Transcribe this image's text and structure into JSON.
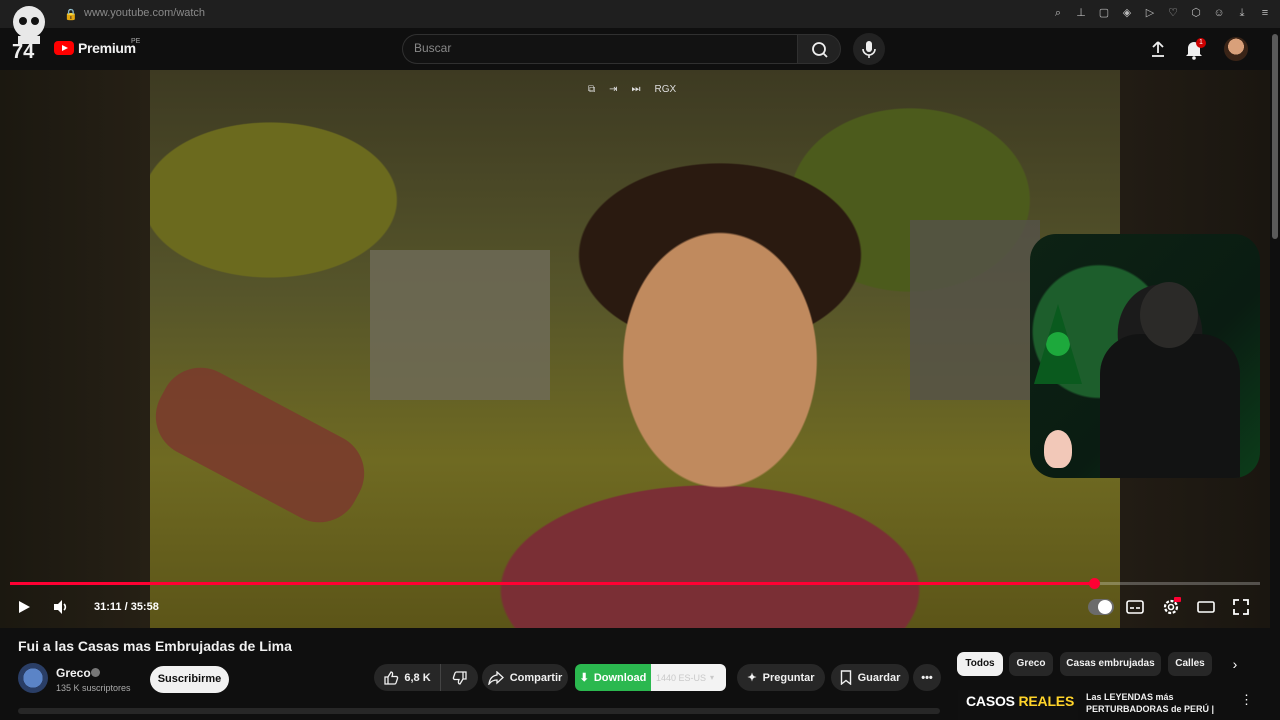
{
  "browser": {
    "url": "www.youtube.com/watch",
    "ext_icons": [
      "zoom-icon",
      "pin-icon",
      "crop-icon",
      "shield-icon",
      "play-icon",
      "heart-icon",
      "extension-icon",
      "person-icon",
      "download-icon",
      "menu-icon"
    ]
  },
  "header": {
    "logo_text": "Premium",
    "logo_country": "PE",
    "search_placeholder": "Buscar",
    "notifications_count": "1"
  },
  "player": {
    "overlay_label": "RGX",
    "current_time": "31:11",
    "duration": "35:58",
    "time_display": "31:11 / 35:58",
    "progress_fraction": 0.867,
    "accent_color": "#ff0033"
  },
  "video": {
    "title": "Fui a las Casas mas Embrujadas de Lima",
    "channel_name": "Greco",
    "subscribers": "135 K suscriptores",
    "subscribe_label": "Suscribirme"
  },
  "actions": {
    "likes": "6,8 K",
    "share_label": "Compartir",
    "download_label": "Download",
    "download_quality": "1440 ES-US",
    "ask_label": "Preguntar",
    "save_label": "Guardar"
  },
  "chips": [
    {
      "label": "Todos",
      "active": true
    },
    {
      "label": "Greco",
      "active": false
    },
    {
      "label": "Casas embrujadas",
      "active": false
    },
    {
      "label": "Calles",
      "active": false
    }
  ],
  "recommendation": {
    "thumb_text_a": "CASOS",
    "thumb_text_b": "REALES",
    "title": "Las LEYENDAS más PERTURBADORAS de PERÚ |"
  }
}
